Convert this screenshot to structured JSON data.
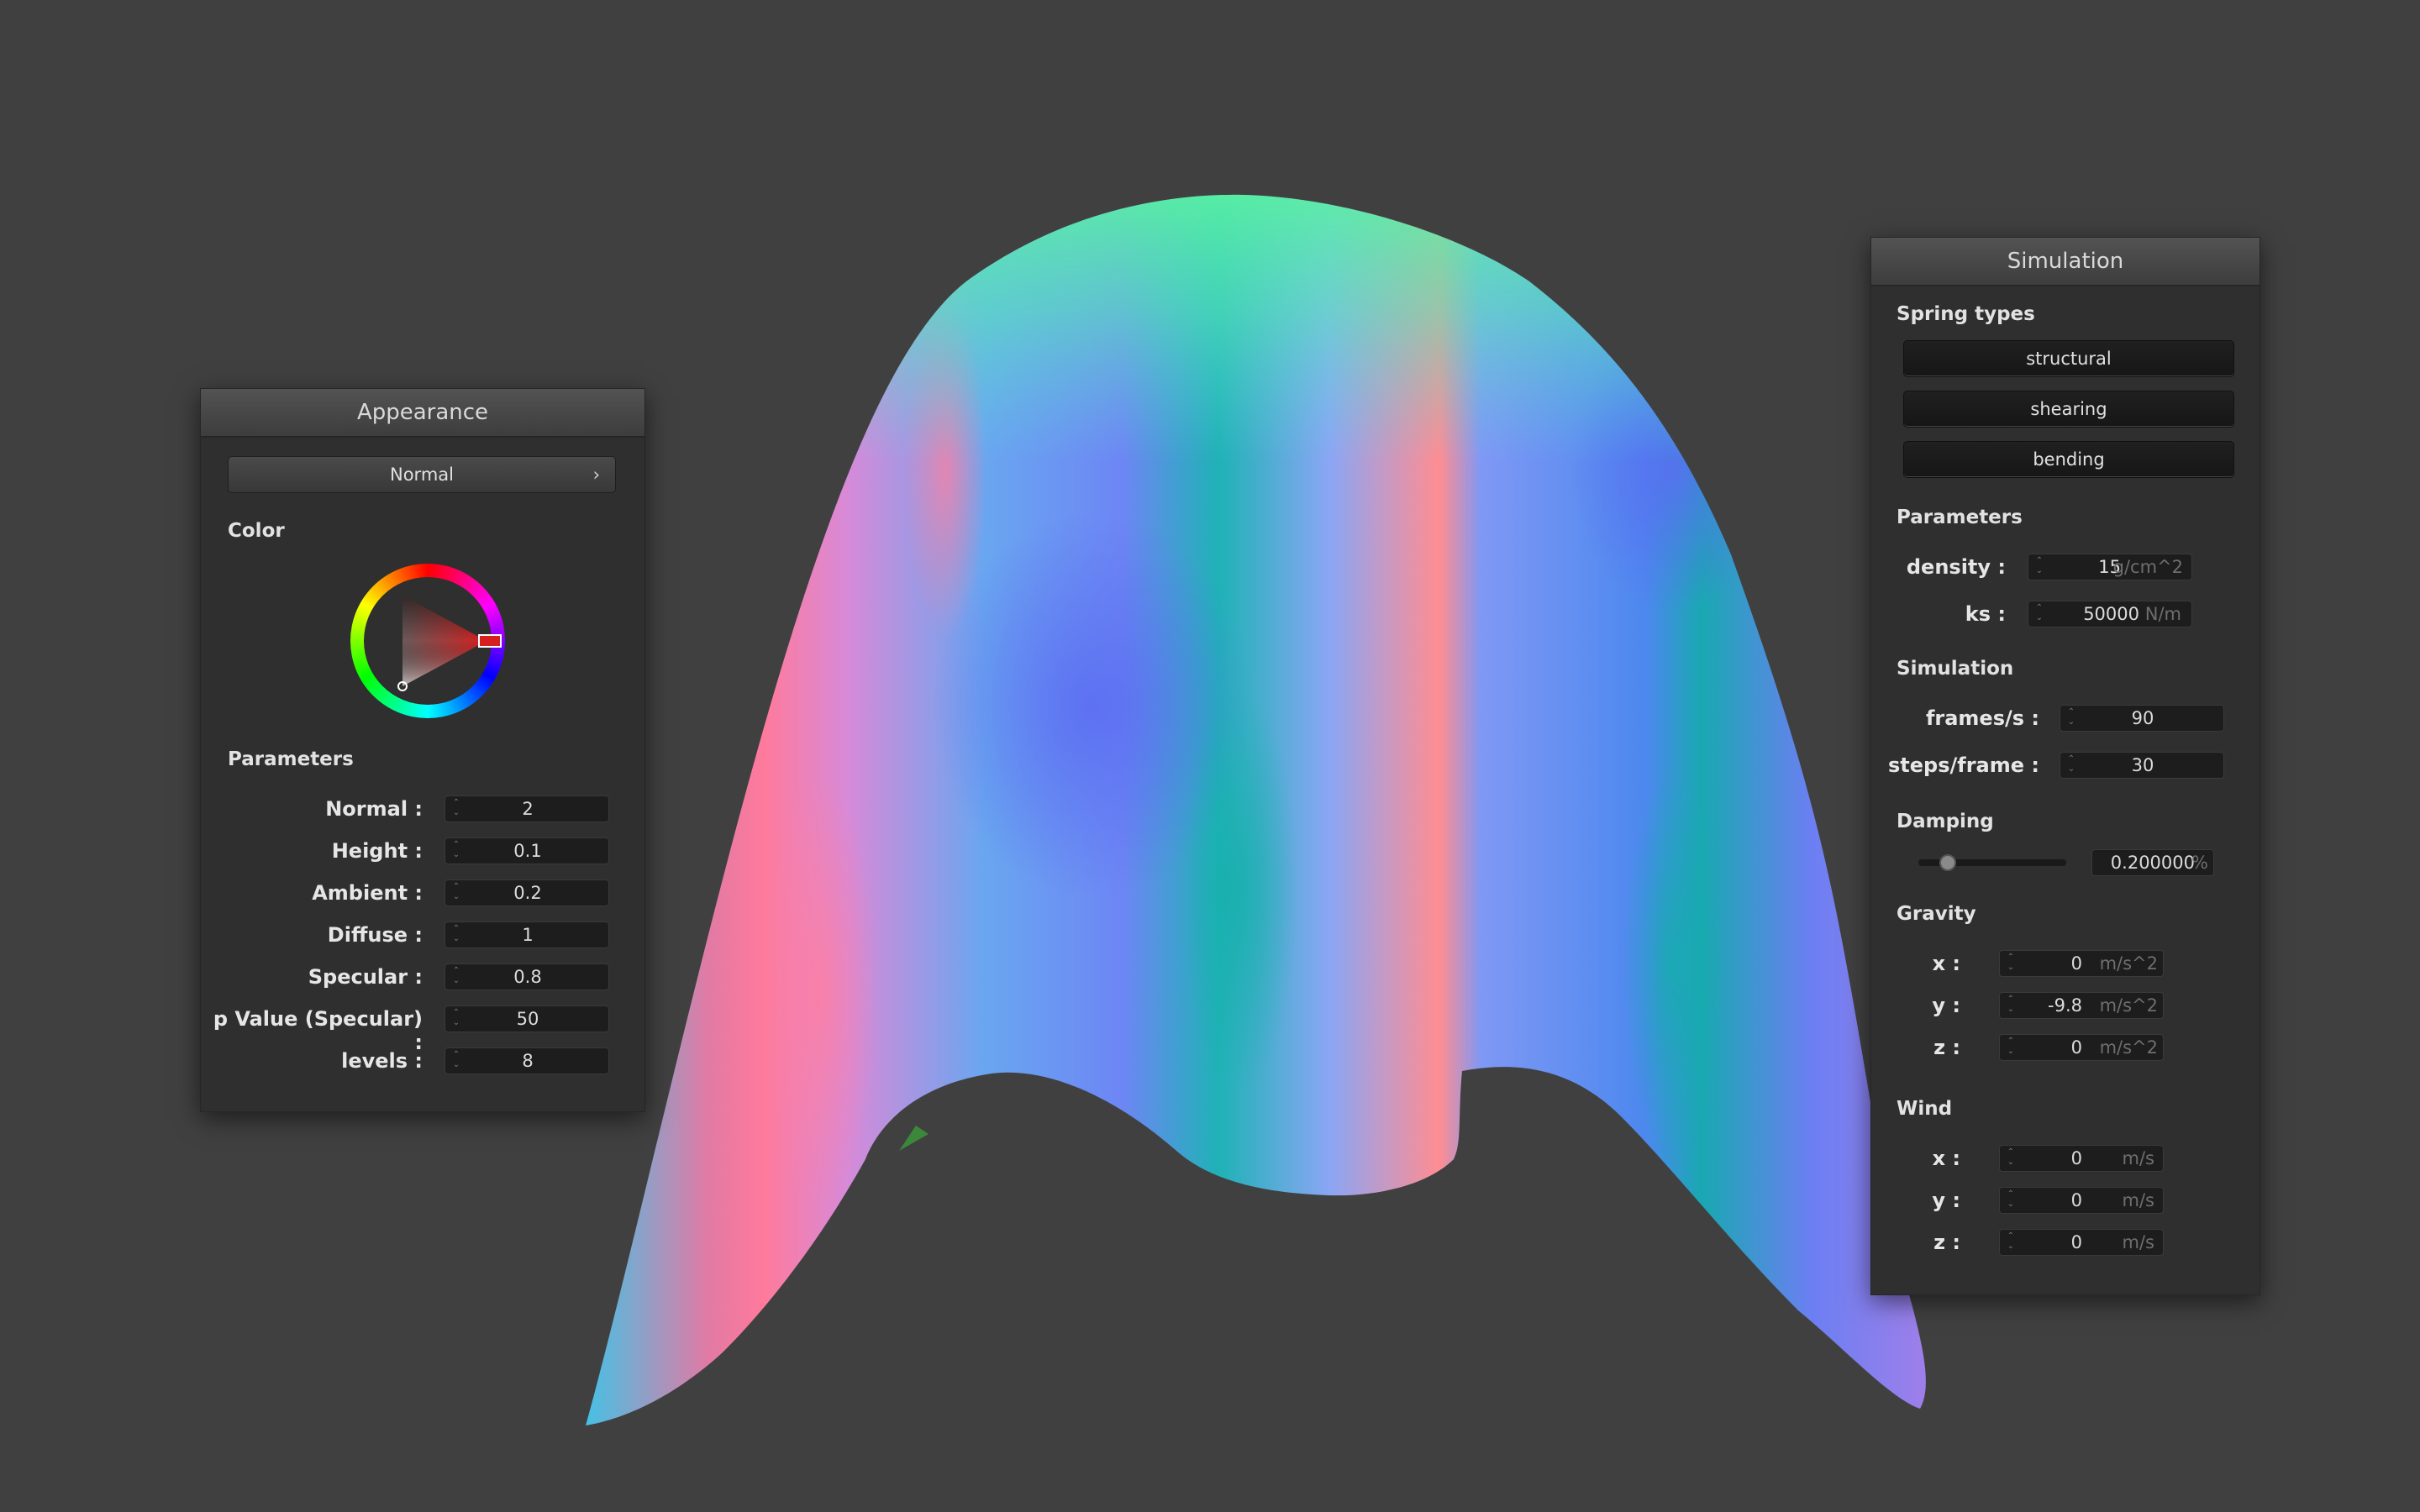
{
  "appearance": {
    "title": "Appearance",
    "mode_select": "Normal",
    "mode_arrow": "›",
    "color_section": "Color",
    "picked_color": "#d61f1f",
    "params_section": "Parameters",
    "params": [
      {
        "label": "Normal :",
        "value": "2"
      },
      {
        "label": "Height :",
        "value": "0.1"
      },
      {
        "label": "Ambient :",
        "value": "0.2"
      },
      {
        "label": "Diffuse :",
        "value": "1"
      },
      {
        "label": "Specular :",
        "value": "0.8"
      },
      {
        "label": "p Value (Specular) :",
        "value": "50"
      },
      {
        "label": "levels :",
        "value": "8"
      }
    ]
  },
  "simulation": {
    "title": "Simulation",
    "spring_section": "Spring types",
    "spring_buttons": [
      "structural",
      "shearing",
      "bending"
    ],
    "params_section": "Parameters",
    "density": {
      "label": "density :",
      "value": "15",
      "unit": "g/cm^2"
    },
    "ks": {
      "label": "ks :",
      "value": "50000",
      "unit": "N/m"
    },
    "sim_section": "Simulation",
    "frames": {
      "label": "frames/s :",
      "value": "90"
    },
    "steps": {
      "label": "steps/frame :",
      "value": "30"
    },
    "damping_section": "Damping",
    "damping": {
      "value": "0.200000",
      "unit": "%",
      "level": 0.2
    },
    "gravity_section": "Gravity",
    "gravity": [
      {
        "label": "x :",
        "value": "0",
        "unit": "m/s^2"
      },
      {
        "label": "y :",
        "value": "-9.8",
        "unit": "m/s^2"
      },
      {
        "label": "z :",
        "value": "0",
        "unit": "m/s^2"
      }
    ],
    "wind_section": "Wind",
    "wind": [
      {
        "label": "x :",
        "value": "0",
        "unit": "m/s"
      },
      {
        "label": "y :",
        "value": "0",
        "unit": "m/s"
      },
      {
        "label": "z :",
        "value": "0",
        "unit": "m/s"
      }
    ]
  }
}
